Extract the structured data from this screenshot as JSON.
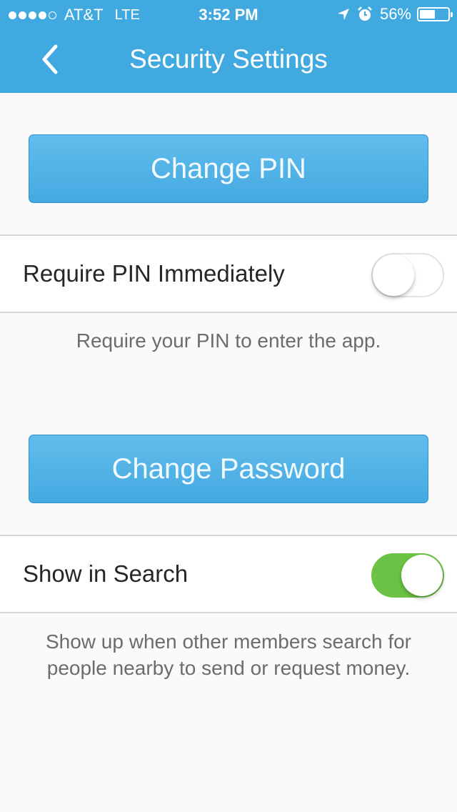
{
  "status_bar": {
    "signal_strength": 4,
    "signal_max": 5,
    "carrier": "AT&T",
    "network": "LTE",
    "time": "3:52 PM",
    "battery_percent": "56%",
    "battery_level": 0.56,
    "icons": [
      "location-arrow-icon",
      "alarm-icon",
      "battery-icon"
    ]
  },
  "header": {
    "title": "Security Settings",
    "back_icon": "chevron-left-icon",
    "background_color": "#40a9e0"
  },
  "buttons": {
    "change_pin": "Change PIN",
    "change_password": "Change Password"
  },
  "settings": [
    {
      "label": "Require PIN Immediately",
      "enabled": false,
      "description": "Require your PIN to enter the app."
    },
    {
      "label": "Show in Search",
      "enabled": true,
      "description": "Show up when other members search for people nearby to send or request money."
    }
  ],
  "colors": {
    "accent": "#40a9e0",
    "toggle_on": "#6cc244"
  }
}
